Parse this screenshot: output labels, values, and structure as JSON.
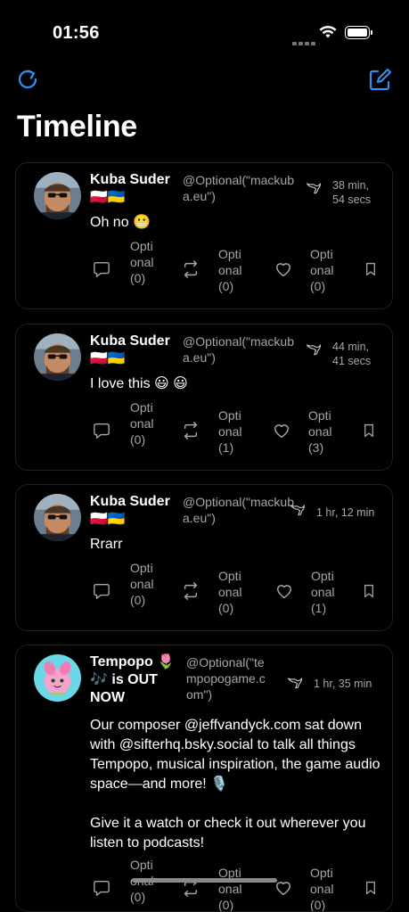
{
  "status": {
    "time": "01:56"
  },
  "header": {
    "title": "Timeline"
  },
  "posts": [
    {
      "author": "Kuba Suder 🇵🇱🇺🇦",
      "handle": "@Optional(\"mackuba.eu\")",
      "time": "38 min, 54 secs",
      "text": "Oh no 😬",
      "replies": "Optional(0)",
      "reposts": "Optional(0)",
      "likes": "Optional(0)"
    },
    {
      "author": "Kuba Suder 🇵🇱🇺🇦",
      "handle": "@Optional(\"mackuba.eu\")",
      "time": "44 min, 41 secs",
      "text": "I love this 😃 😃",
      "replies": "Optional(0)",
      "reposts": "Optional(1)",
      "likes": "Optional(3)"
    },
    {
      "author": "Kuba Suder 🇵🇱🇺🇦",
      "handle": "@Optional(\"mackuba.eu\")",
      "time": "1 hr, 12 min",
      "text": "Rrarr",
      "replies": "Optional(0)",
      "reposts": "Optional(0)",
      "likes": "Optional(1)"
    },
    {
      "author": "Tempopo 🌷🎶 is OUT NOW",
      "handle": "@Optional(\"tempopogame.com\")",
      "time": "1 hr, 35 min",
      "text": "Our composer @jeffvandyck.com sat down with @sifterhq.bsky.social to talk all things Tempopo, musical inspiration, the game audio space—and more! 🎙️\n\nGive it a watch or check it out wherever you listen to podcasts!",
      "replies": "Optional(0)",
      "reposts": "Optional(0)",
      "likes": "Optional(0)"
    }
  ],
  "colors": {
    "accent": "#2f8ef7",
    "background": "#000000",
    "secondary_text": "#a6a6a6",
    "card_border": "#1f1f1f"
  },
  "icons": [
    "refresh-icon",
    "compose-icon",
    "bird-icon",
    "reply-icon",
    "repost-icon",
    "like-icon",
    "bookmark-icon"
  ]
}
